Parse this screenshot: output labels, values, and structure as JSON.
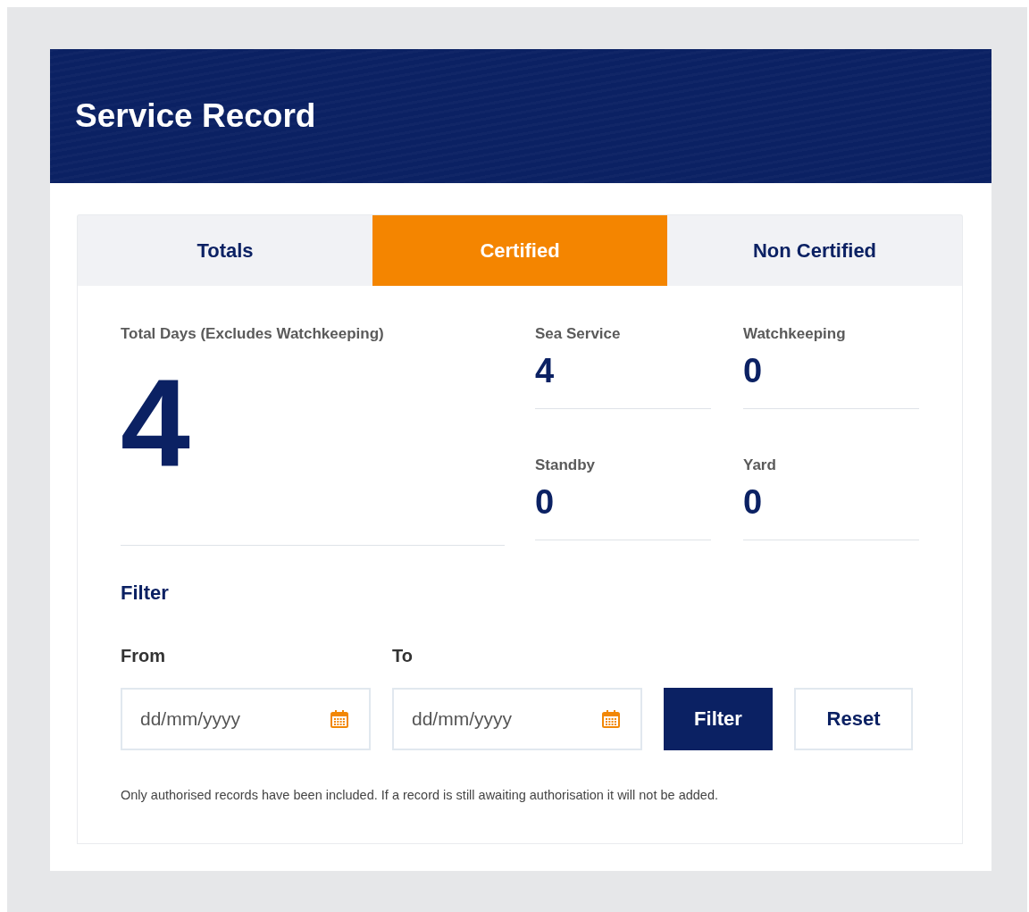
{
  "header": {
    "title": "Service Record"
  },
  "tabs": [
    {
      "label": "Totals",
      "selected": false
    },
    {
      "label": "Certified",
      "selected": true
    },
    {
      "label": "Non Certified",
      "selected": false
    }
  ],
  "total": {
    "label": "Total Days (Excludes Watchkeeping)",
    "value": "4"
  },
  "stats": [
    {
      "label": "Sea Service",
      "value": "4"
    },
    {
      "label": "Watchkeeping",
      "value": "0"
    },
    {
      "label": "Standby",
      "value": "0"
    },
    {
      "label": "Yard",
      "value": "0"
    }
  ],
  "filter": {
    "heading": "Filter",
    "fields": [
      {
        "label": "From",
        "placeholder": "dd/mm/yyyy"
      },
      {
        "label": "To",
        "placeholder": "dd/mm/yyyy"
      }
    ],
    "buttons": [
      {
        "label": "Filter",
        "kind": "primary"
      },
      {
        "label": "Reset",
        "kind": "secondary"
      }
    ]
  },
  "note": "Only authorised records have been included. If a record is still awaiting authorisation it will not be added."
}
